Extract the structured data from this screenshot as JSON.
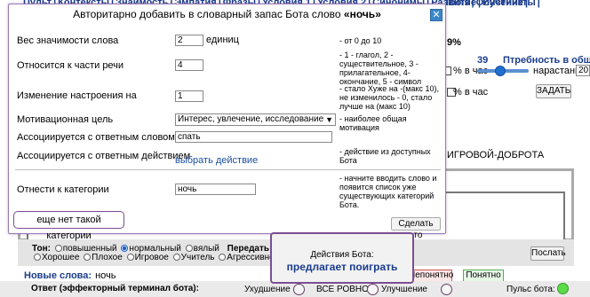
{
  "top_nav": {
    "start_items": [
      "Пульт",
      "Контексты",
      "Знаимость",
      "Эмпатия",
      "Фразы",
      "Условия 1",
      "Условия 2",
      "Синонимы",
      "Развитие",
      "Инстинкты"
    ],
    "end_items": [
      "Tools",
      "Обучение"
    ]
  },
  "background": {
    "percent_readout": "9%",
    "need_value": "39",
    "need_label": "Птребность в общени",
    "per_hour_1": "% в час",
    "growth_label": "нарастание",
    "growth_value": "20",
    "per_hour_2": "% в час",
    "set_button": "ЗАДАТЬ",
    "game_label": "ИГРОВОЙ-ДОБРОТА",
    "tone_label": "Тон:",
    "tones_row1": [
      "повышенный",
      "нормальный",
      "вялый"
    ],
    "tone_selected": "нормальный",
    "context_label": "Передать контекс",
    "tones_row2": [
      "Хорошее",
      "Плохое",
      "Игровое",
      "Учитель",
      "Агрессивно"
    ],
    "send_button": "Послать",
    "not_understood_button": "Непонятно",
    "understood_button": "Понятно",
    "new_words_label": "Новые слова:",
    "new_word": "ночь",
    "answer_label": "Ответ (эффекторный терминал бота):",
    "state_worse": "Ухудшение",
    "state_same": "ВСЕ РОВНО",
    "state_better": "Улучшение",
    "pulse_label": "Пульс бота:"
  },
  "modal": {
    "title_prefix": "Авторитарно добавить в словарный запас Бота слово ",
    "title_word": "«ночь»",
    "close_icon": "✕",
    "weight_label": "Вес значимости слова",
    "weight_value": "2",
    "weight_unit": "единиц",
    "weight_note": "- от 0 до 10",
    "pos_label": "Относится к части речи",
    "pos_value": "4",
    "pos_note": "- 1 - глагол, 2 - существительное, 3 - прилагательное, 4- окончание, 5 - символ",
    "mood_label": "Изменение настроения на",
    "mood_value": "1",
    "mood_note": "- стало Хуже на -(макс 10), не изменилось - 0, стало лучше на (макс 10)",
    "motive_label": "Мотивационная цель",
    "motive_value": "Интерес, увлечение, исследование",
    "motive_note": "- наиболее общая мотивация",
    "assoc_word_label": "Ассоциируется с ответным словом",
    "assoc_word_value": "спать",
    "assoc_action_label": "Ассоциируется с ответным действием",
    "assoc_action_link": "выбрать действие",
    "assoc_action_note": "- действие из доступных Бота",
    "category_label": "Отнести к категории",
    "category_value": "ночь",
    "category_note": "- начните вводить слово и появится список уже существующих категорий Бота.",
    "no_category_alert": "еще нет такой категории",
    "do_button": "Сделать это"
  },
  "bot_popup": {
    "title": "Действия Бота:",
    "action": "предлагает поиграть"
  }
}
